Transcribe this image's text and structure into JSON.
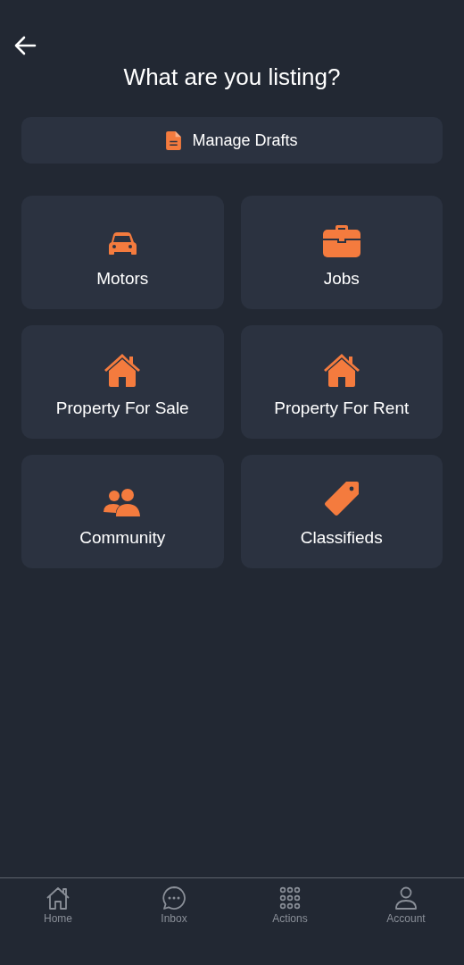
{
  "header": {
    "title": "What are you listing?"
  },
  "drafts_button": {
    "label": "Manage Drafts"
  },
  "categories": [
    {
      "label": "Motors",
      "kind": "car"
    },
    {
      "label": "Jobs",
      "kind": "briefcase"
    },
    {
      "label": "Property For Sale",
      "kind": "house"
    },
    {
      "label": "Property For Rent",
      "kind": "house"
    },
    {
      "label": "Community",
      "kind": "people"
    },
    {
      "label": "Classifieds",
      "kind": "tag"
    }
  ],
  "tab_bar": [
    {
      "label": "Home",
      "kind": "home"
    },
    {
      "label": "Inbox",
      "kind": "chat"
    },
    {
      "label": "Actions",
      "kind": "grid"
    },
    {
      "label": "Account",
      "kind": "person"
    }
  ]
}
